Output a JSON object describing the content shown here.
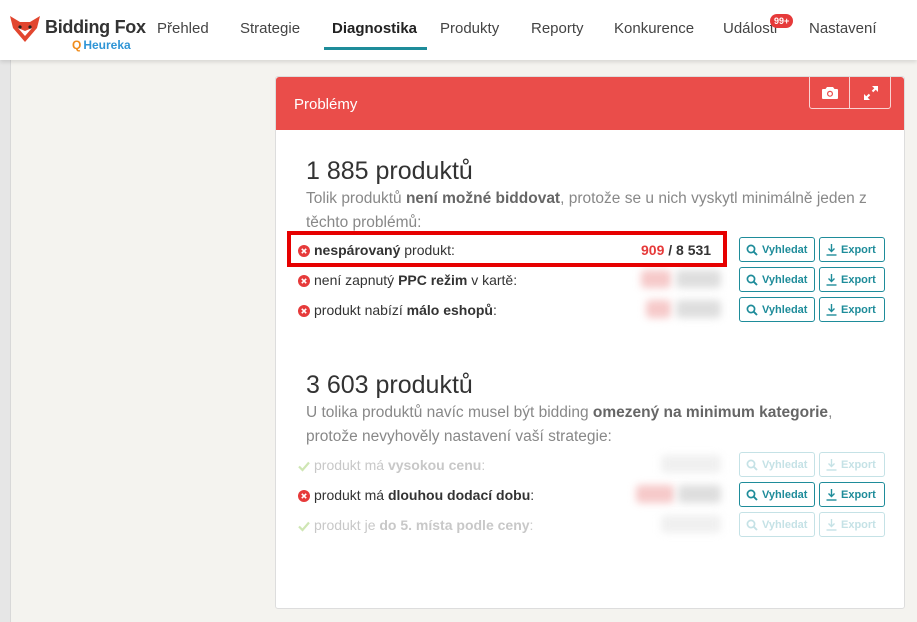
{
  "nav": {
    "brand": "Bidding Fox",
    "sub_brand": "Heureka",
    "items": [
      {
        "label": "Přehled",
        "active": false
      },
      {
        "label": "Strategie",
        "active": false
      },
      {
        "label": "Diagnostika",
        "active": true
      },
      {
        "label": "Produkty",
        "active": false
      },
      {
        "label": "Reporty",
        "active": false
      },
      {
        "label": "Konkurence",
        "active": false
      },
      {
        "label": "Události",
        "active": false
      },
      {
        "label": "Nastavení",
        "active": false
      }
    ],
    "events_badge": "99+"
  },
  "card": {
    "title": "Problémy",
    "section1": {
      "count_text": "1 885 produktů",
      "desc_a": "Tolik produktů ",
      "desc_b": "není možné biddovat",
      "desc_c": ", protože se u nich vyskytl minimálně jeden z těchto problémů:"
    },
    "section2": {
      "count_text": "3 603 produktů",
      "desc_a": "U tolika produktů navíc musel být bidding ",
      "desc_b": "omezený na minimum kategorie",
      "desc_c": ", protože nevyhověly nastavení vaší strategie:"
    },
    "rows1": [
      {
        "pre": "",
        "bold": "nespárovaný",
        "post": " produkt:",
        "count_red": "909",
        "count_sep": " / ",
        "count_total": "8 531"
      },
      {
        "pre": "není zapnutý ",
        "bold": "PPC režim",
        "post": " v kartě:"
      },
      {
        "pre": "produkt nabízí ",
        "bold": "málo eshopů",
        "post": ":"
      }
    ],
    "rows2": [
      {
        "pre": "produkt má ",
        "bold": "vysokou cenu",
        "post": ":"
      },
      {
        "pre": "produkt má ",
        "bold": "dlouhou dodací dobu",
        "post": ":"
      },
      {
        "pre": "produkt je ",
        "bold": "do 5. místa podle ceny",
        "post": ":"
      }
    ],
    "search_label": "Vyhledat",
    "export_label": "Export"
  },
  "colors": {
    "header_red": "#ea4d4a",
    "accent_teal": "#1e8c9a",
    "error_red": "#e63a3a",
    "highlight_red": "#e60000"
  }
}
